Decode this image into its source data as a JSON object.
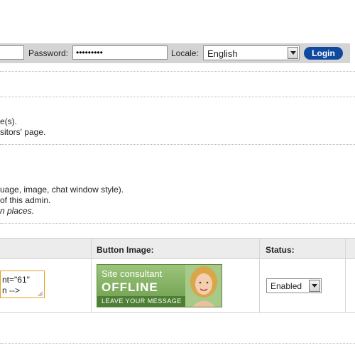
{
  "login": {
    "password_label": "Password:",
    "password_value": "•••••••••",
    "locale_label": "Locale:",
    "locale_value": "English",
    "login_button": "Login"
  },
  "info1": {
    "line1": "e(s).",
    "line2": "sitors' page."
  },
  "info2": {
    "line1": "uage, image, chat window style).",
    "line2": "of this admin.",
    "line3": "n places."
  },
  "table": {
    "headers": [
      "Button Image:",
      "Status:"
    ],
    "code_lines": [
      "nt=\"61\"",
      "n -->"
    ],
    "status_value": "Enabled"
  },
  "banner": {
    "line1": "Site consultant",
    "line2": "OFFLINE",
    "line3": "LEAVE YOUR MESSAGE"
  },
  "icons": [
    "chevron-down-icon",
    "resize-grip-icon"
  ]
}
